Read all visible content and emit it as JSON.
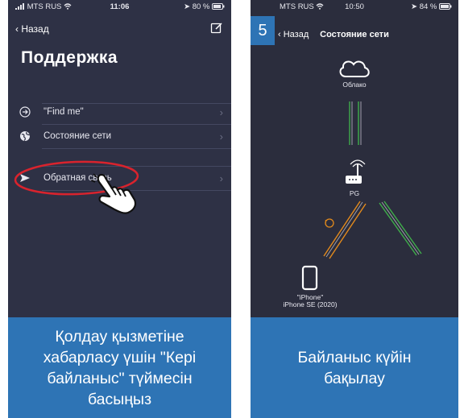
{
  "left": {
    "status": {
      "carrier": "MTS RUS",
      "time": "11:06",
      "battery": "80 %"
    },
    "nav": {
      "back_label": "Назад"
    },
    "title": "Поддержка",
    "menu": [
      {
        "label": "\"Find me\"",
        "icon": "arrow-right-circle-icon"
      },
      {
        "label": "Состояние сети",
        "icon": "globe-icon"
      },
      {
        "label": "Обратная связь",
        "icon": "send-icon"
      }
    ],
    "caption": "Қолдау қызметіне\nхабарласу үшін \"Кері\nбайланыс\" түймесін\nбасыңыз",
    "highlight_color": "#d9232d"
  },
  "right": {
    "step_badge": "5",
    "status": {
      "carrier": "MTS RUS",
      "time": "10:50",
      "battery": "84 %"
    },
    "nav": {
      "back_label": "Назад",
      "title": "Состояние сети"
    },
    "nodes": {
      "cloud": "Облако",
      "router": "PG",
      "device_name": "\"iPhone\"",
      "device_model": "iPhone SE (2020)"
    },
    "warning_symbol": "!",
    "caption": "Байланыс күйін\nбақылау",
    "link_colors": {
      "ok": "#3fae4a",
      "warning": "#e38a1c"
    }
  }
}
